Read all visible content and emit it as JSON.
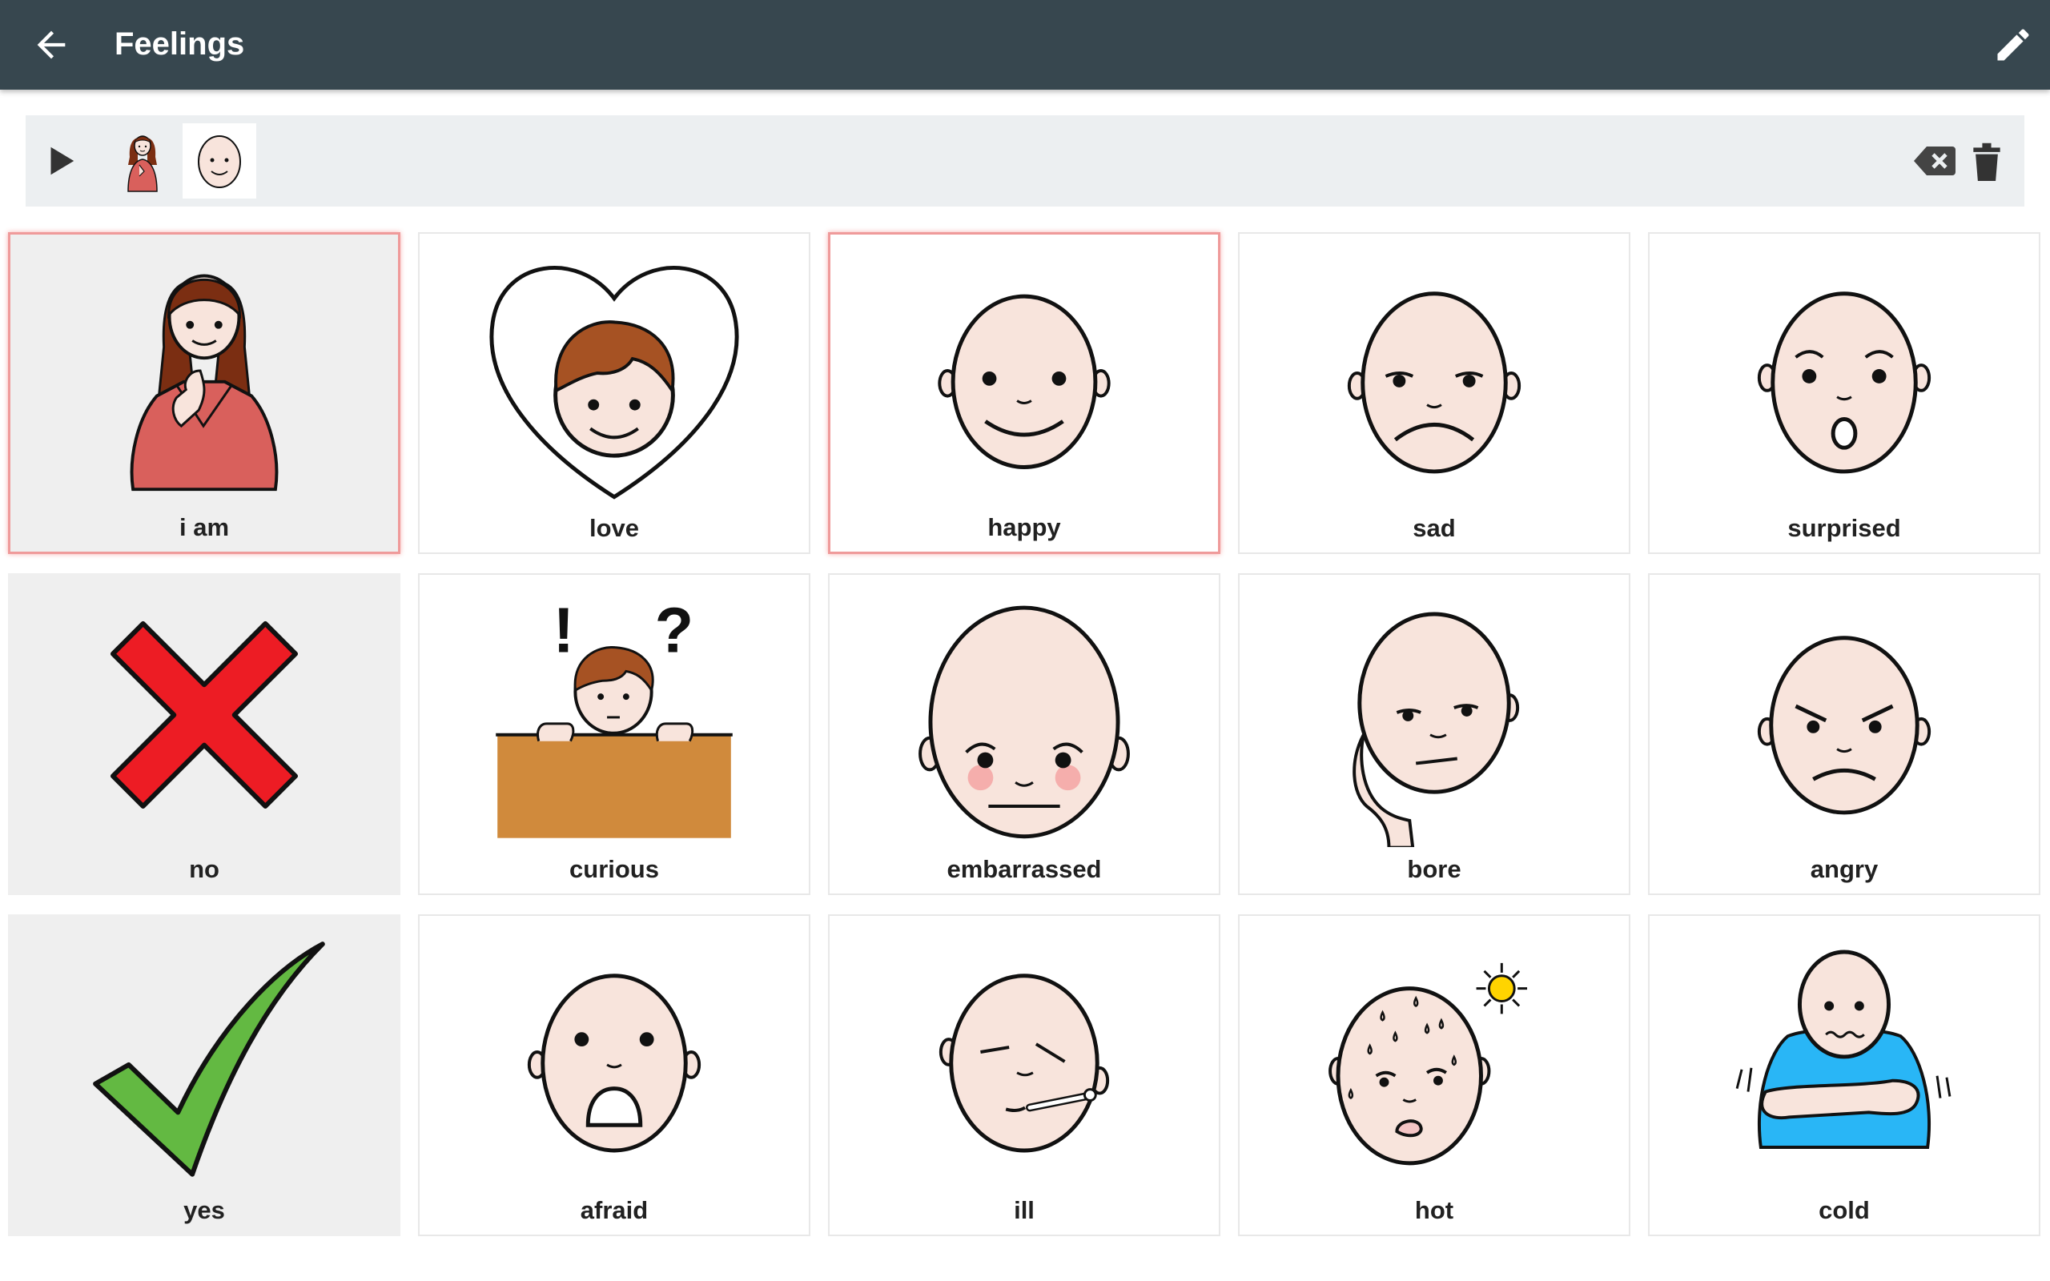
{
  "header": {
    "title": "Feelings",
    "back_icon": "arrow-back-icon",
    "edit_icon": "pencil-edit-icon",
    "color": "#37474f"
  },
  "sentence_bar": {
    "play_icon": "play-icon",
    "items": [
      {
        "symbol": "i am"
      },
      {
        "symbol": "happy"
      }
    ],
    "backspace_icon": "backspace-icon",
    "clear_icon": "trash-icon"
  },
  "tiles": [
    {
      "label": "i am",
      "icon": "woman-pointing-self-icon",
      "selected": true,
      "background": "grey"
    },
    {
      "label": "love",
      "icon": "boy-in-heart-icon",
      "selected": false,
      "background": "white"
    },
    {
      "label": "happy",
      "icon": "happy-face-icon",
      "selected": true,
      "background": "white"
    },
    {
      "label": "sad",
      "icon": "sad-face-icon",
      "selected": false,
      "background": "white"
    },
    {
      "label": "surprised",
      "icon": "surprised-face-icon",
      "selected": false,
      "background": "white"
    },
    {
      "label": "no",
      "icon": "red-cross-icon",
      "selected": false,
      "background": "grey"
    },
    {
      "label": "curious",
      "icon": "curious-boy-icon",
      "selected": false,
      "background": "white"
    },
    {
      "label": "embarrassed",
      "icon": "embarrassed-face-icon",
      "selected": false,
      "background": "white"
    },
    {
      "label": "bore",
      "icon": "bored-face-icon",
      "selected": false,
      "background": "white"
    },
    {
      "label": "angry",
      "icon": "angry-face-icon",
      "selected": false,
      "background": "white"
    },
    {
      "label": "yes",
      "icon": "green-check-icon",
      "selected": false,
      "background": "grey"
    },
    {
      "label": "afraid",
      "icon": "afraid-face-icon",
      "selected": false,
      "background": "white"
    },
    {
      "label": "ill",
      "icon": "ill-face-icon",
      "selected": false,
      "background": "white"
    },
    {
      "label": "hot",
      "icon": "hot-face-icon",
      "selected": false,
      "background": "white"
    },
    {
      "label": "cold",
      "icon": "cold-boy-icon",
      "selected": false,
      "background": "white"
    }
  ],
  "colors": {
    "skin": "#f8e4dc",
    "selected_border": "#ef9a9a",
    "cross_red": "#ed1c24",
    "check_green": "#63b942"
  }
}
